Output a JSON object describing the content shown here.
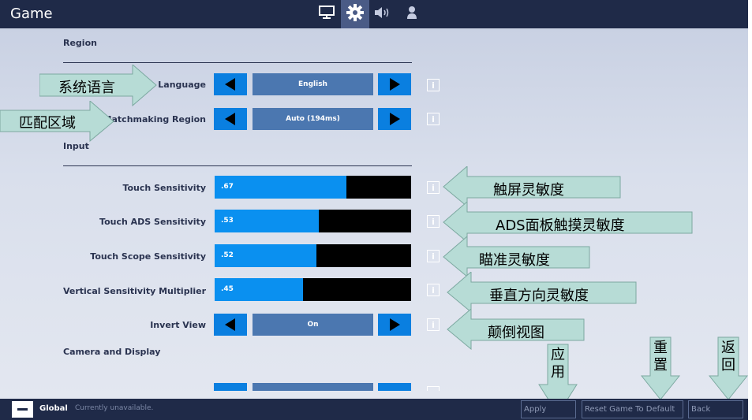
{
  "window": {
    "title": "Game"
  },
  "tabs": [
    {
      "name": "display",
      "icon": "monitor-icon"
    },
    {
      "name": "game",
      "icon": "gear-icon",
      "active": true
    },
    {
      "name": "audio",
      "icon": "speaker-icon"
    },
    {
      "name": "account",
      "icon": "person-icon"
    }
  ],
  "sections": {
    "region": "Region",
    "input": "Input",
    "camera": "Camera and Display"
  },
  "settings": {
    "language": {
      "label": "Language",
      "value": "English"
    },
    "matchmaking": {
      "label": "Matchmaking Region",
      "value": "Auto (194ms)"
    },
    "invert": {
      "label": "Invert View",
      "value": "On"
    }
  },
  "sliders": [
    {
      "label": "Touch Sensitivity",
      "text": ".67",
      "value": 0.67
    },
    {
      "label": "Touch ADS Sensitivity",
      "text": ".53",
      "value": 0.53
    },
    {
      "label": "Touch Scope Sensitivity",
      "text": ".52",
      "value": 0.52
    },
    {
      "label": "Vertical Sensitivity Multiplier",
      "text": ".45",
      "value": 0.45
    }
  ],
  "annotations": {
    "language": "系统语言",
    "matchmaking": "匹配区域",
    "touch": "触屏灵敏度",
    "ads": "ADS面板触摸灵敏度",
    "scope": "瞄准灵敏度",
    "vertical": "垂直方向灵敏度",
    "invert": "颠倒视图",
    "apply": "应用",
    "reset": "重置",
    "back": "返回"
  },
  "footer": {
    "global": "Global",
    "status": "Currently unavailable.",
    "apply": "Apply",
    "reset": "Reset Game To Default",
    "back": "Back"
  },
  "colors": {
    "accent": "#0a90f0",
    "button": "#0a7fe0",
    "value_box": "#4b77b0",
    "header": "#1f2a48",
    "annotation": "#b7dcd6"
  }
}
